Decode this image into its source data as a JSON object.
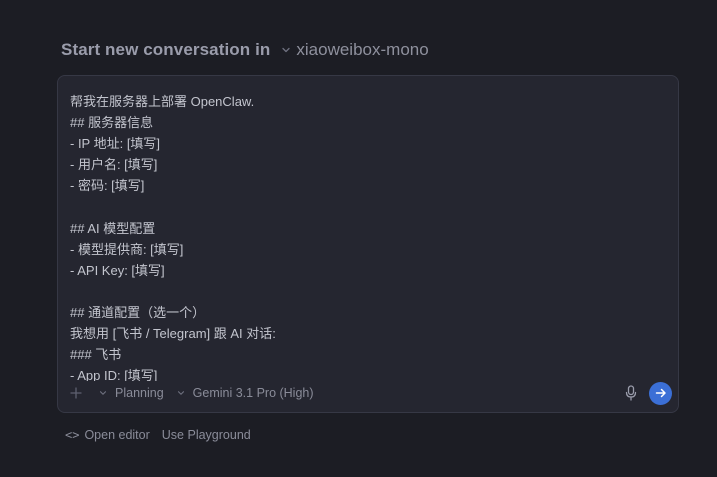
{
  "header": {
    "title": "Start new conversation in",
    "workspace": "xiaoweibox-mono"
  },
  "composer": {
    "lines": [
      "帮我在服务器上部署 OpenClaw.",
      "## 服务器信息",
      "- IP 地址: [填写]",
      "- 用户名: [填写]",
      "- 密码: [填写]",
      "",
      "## AI 模型配置",
      "- 模型提供商: [填写]",
      "- API Key: [填写]",
      "",
      "## 通道配置（选一个）",
      "我想用 [飞书 / Telegram] 跟 AI 对话:",
      "### 飞书",
      "- App ID: [填写]"
    ]
  },
  "toolbar": {
    "plus_icon": "plus-icon",
    "mode_label": "Planning",
    "model_label": "Gemini 3.1 Pro (High)",
    "mic_icon": "microphone-icon",
    "send_icon": "arrow-right-icon",
    "send_color": "#3b6fd6"
  },
  "footer": {
    "open_editor_label": "Open editor",
    "playground_label": "Use Playground",
    "code_icon_glyph": "<>"
  }
}
